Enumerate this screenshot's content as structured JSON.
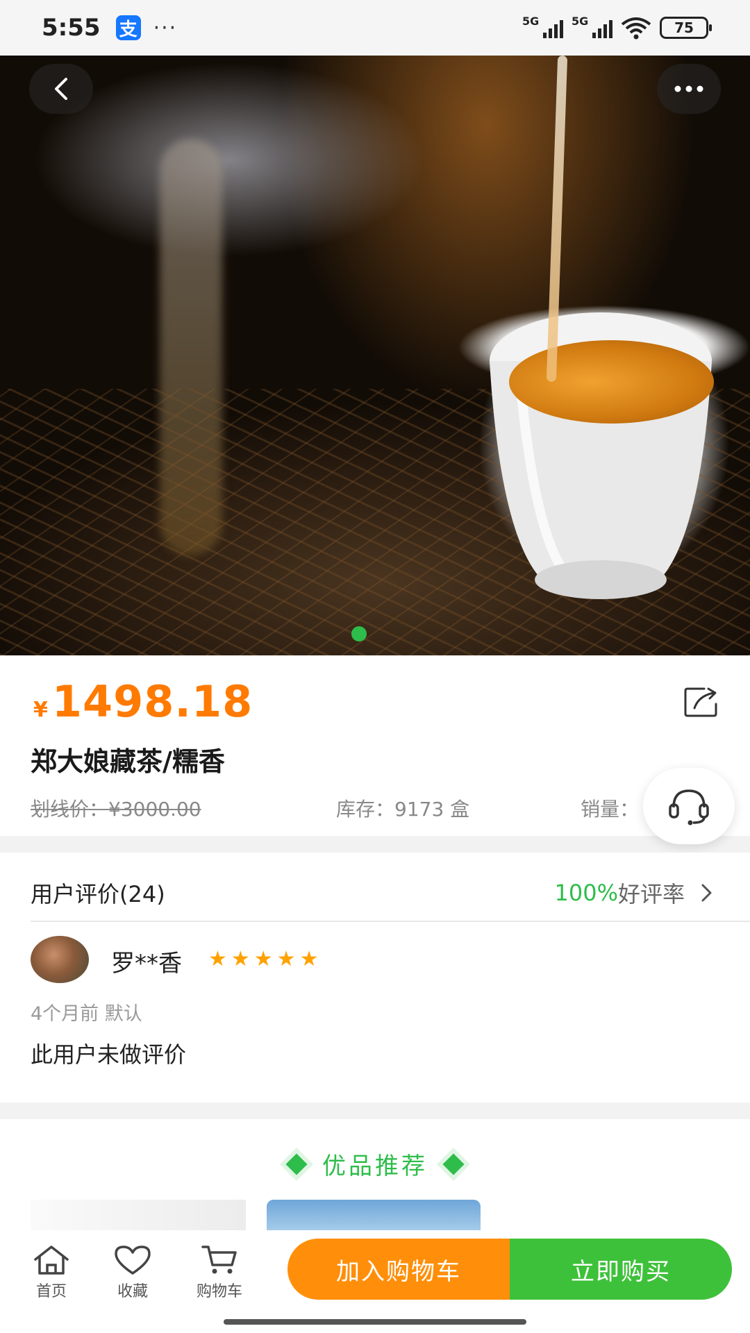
{
  "status_bar": {
    "time": "5:55",
    "app_badge": "支",
    "dots": "···",
    "sim1": "5G",
    "sim2": "5G",
    "battery": "75"
  },
  "hero": {
    "icons": {
      "back": "chevron-left-icon",
      "more": "more-dots-icon"
    },
    "image_count": 1,
    "active_index": 0
  },
  "product": {
    "currency": "¥",
    "price": "1498.18",
    "title": "郑大娘藏茶/糯香",
    "original_price": "划线价：¥3000.00",
    "stock": "库存：9173 盒",
    "sales": "销量：",
    "share_icon": "share-icon",
    "service_icon": "headset-icon"
  },
  "reviews": {
    "title": "用户评价(24)",
    "rate_value": "100%",
    "rate_label": "好评率",
    "item": {
      "name": "罗**香",
      "stars": "★★★★★",
      "time": "4个月前 默认",
      "text": "此用户未做评价"
    }
  },
  "recommendations": {
    "title": "优品推荐"
  },
  "bottom_bar": {
    "tabs": [
      {
        "label": "首页",
        "icon": "home-icon"
      },
      {
        "label": "收藏",
        "icon": "heart-icon"
      },
      {
        "label": "购物车",
        "icon": "cart-icon"
      }
    ],
    "add_to_cart": "加入购物车",
    "buy_now": "立即购买"
  },
  "colors": {
    "accent_orange": "#ff7a00",
    "accent_green": "#2ebd4a",
    "star": "#ffa200"
  }
}
